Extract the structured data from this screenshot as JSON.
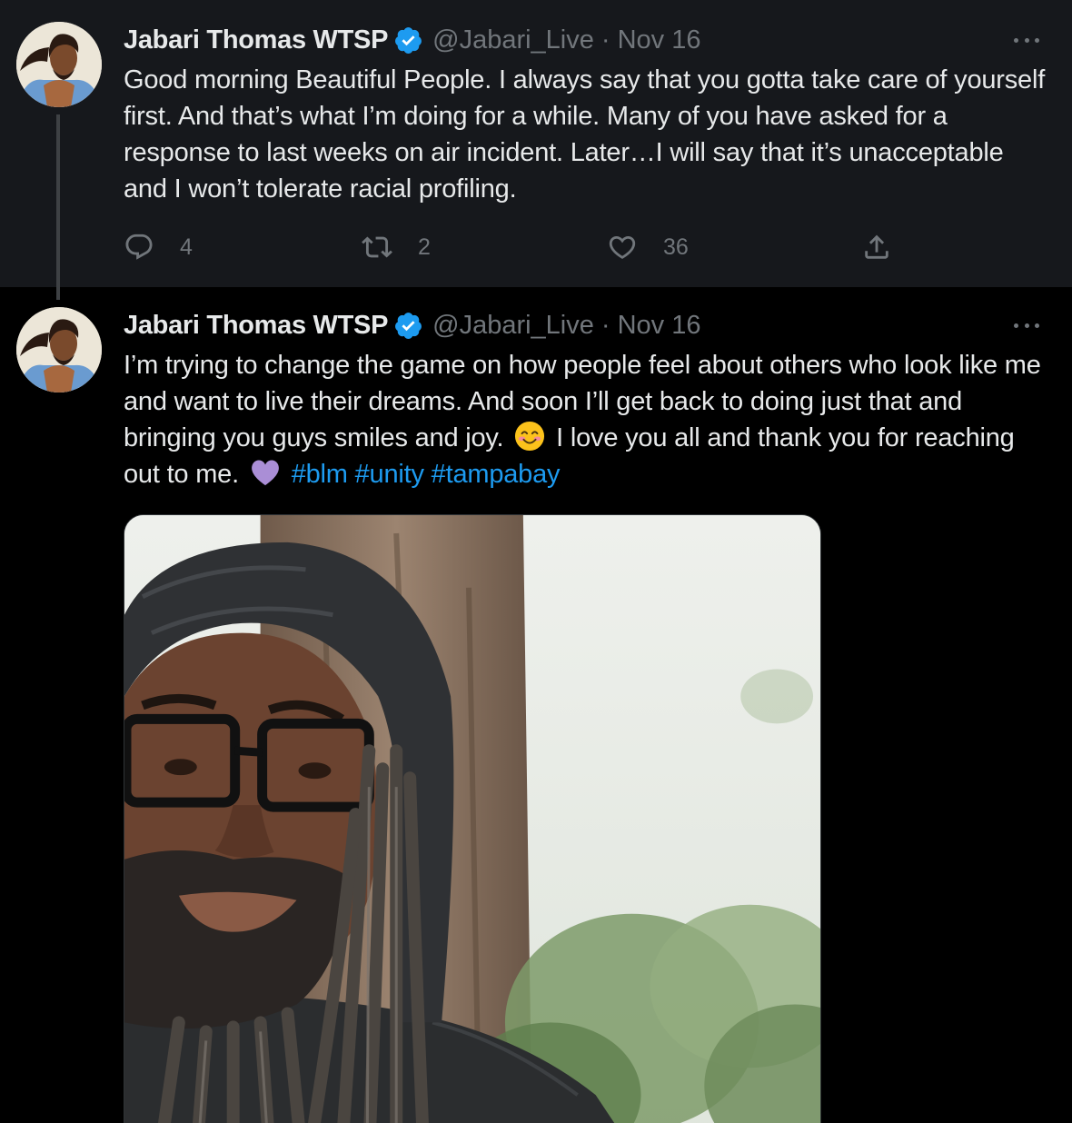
{
  "colors": {
    "background": "#000000",
    "highlighted_tweet_bg": "#16181c",
    "primary_text": "#e7e9ea",
    "secondary_text": "#71767b",
    "link": "#1d9bf0",
    "verified_badge": "#1d9bf0"
  },
  "tweets": [
    {
      "author_name": "Jabari Thomas WTSP",
      "handle": "@Jabari_Live",
      "separator": "·",
      "date": "Nov 16",
      "text": "Good morning Beautiful People. I always say that you gotta take care of yourself first. And that’s what I’m doing for a while. Many of you have asked for a response to last weeks on air incident. Later…I will say that it’s unacceptable and I won’t tolerate racial profiling.",
      "reply_count": "4",
      "retweet_count": "2",
      "like_count": "36",
      "icons": [
        "verified-badge-icon",
        "more-icon",
        "reply-icon",
        "retweet-icon",
        "like-icon",
        "share-icon"
      ]
    },
    {
      "author_name": "Jabari Thomas WTSP",
      "handle": "@Jabari_Live",
      "separator": "·",
      "date": "Nov 16",
      "text_part1": "I’m trying to change the game on how people feel about others who look like me and want to live their dreams. And soon I’ll get back to doing just that and bringing you guys smiles and joy.",
      "emoji_1": "smiling-face-emoji",
      "text_part2": "I love you all and thank you for reaching out to me.",
      "emoji_2": "purple-heart-emoji",
      "hashtags": [
        "#blm",
        "#unity",
        "#tampabay"
      ],
      "media": "photo"
    }
  ]
}
